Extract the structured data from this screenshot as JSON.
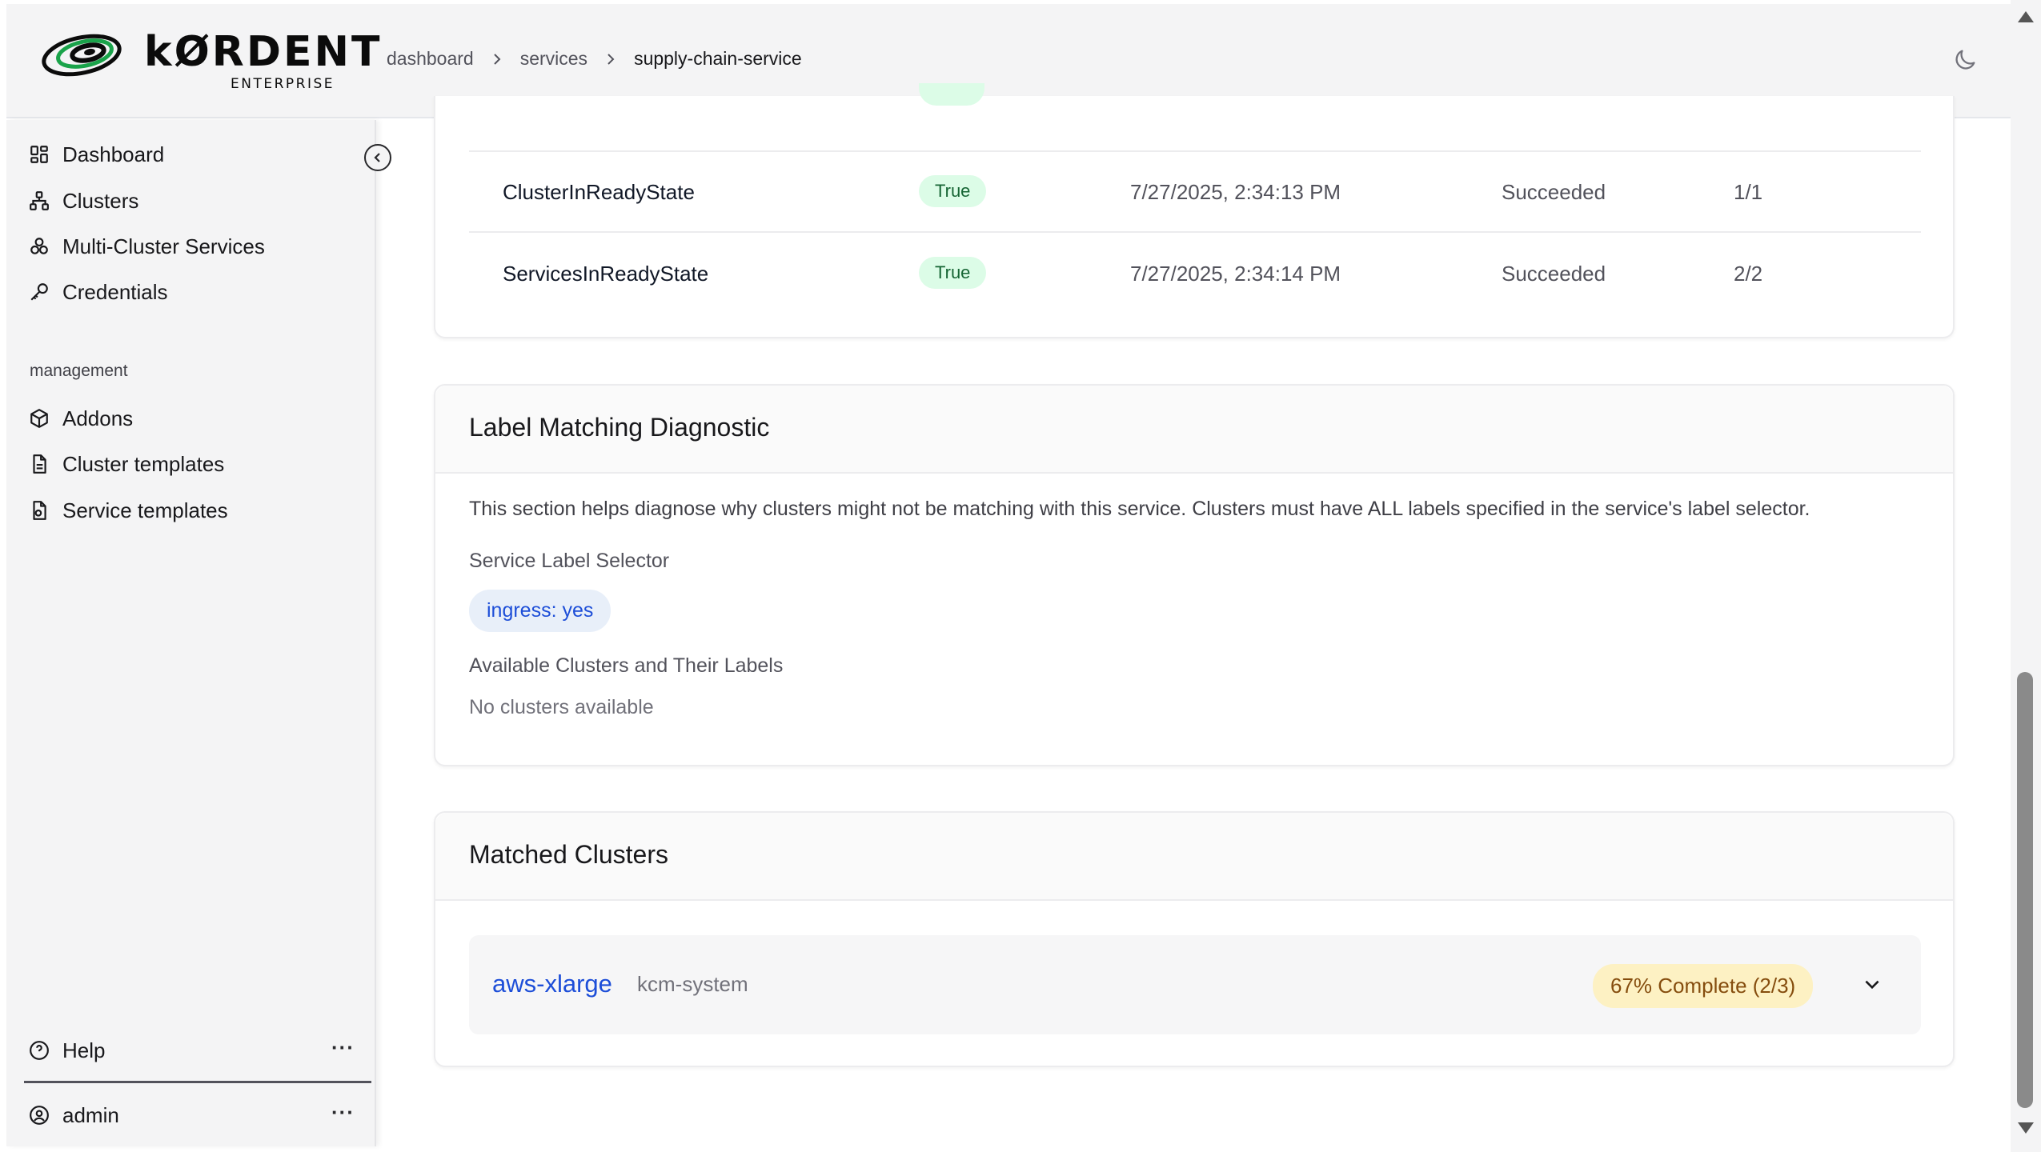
{
  "app": {
    "logo_text": "kØRDENT",
    "logo_sub": "ENTERPRISE"
  },
  "breadcrumb": {
    "items": [
      "dashboard",
      "services",
      "supply-chain-service"
    ]
  },
  "sidebar": {
    "items": [
      {
        "label": "Dashboard",
        "icon": "dashboard-icon"
      },
      {
        "label": "Clusters",
        "icon": "clusters-icon"
      },
      {
        "label": "Multi-Cluster Services",
        "icon": "multi-cluster-icon"
      },
      {
        "label": "Credentials",
        "icon": "key-icon"
      }
    ],
    "section_label": "management",
    "management_items": [
      {
        "label": "Addons",
        "icon": "box-icon"
      },
      {
        "label": "Cluster templates",
        "icon": "file-icon"
      },
      {
        "label": "Service templates",
        "icon": "file-settings-icon"
      }
    ],
    "help_label": "Help",
    "user_label": "admin",
    "more_glyph": "···"
  },
  "conditions": {
    "rows": [
      {
        "name": "ClusterInReadyState",
        "status": "True",
        "time": "7/27/2025, 2:34:13 PM",
        "result": "Succeeded",
        "count": "1/1"
      },
      {
        "name": "ServicesInReadyState",
        "status": "True",
        "time": "7/27/2025, 2:34:14 PM",
        "result": "Succeeded",
        "count": "2/2"
      }
    ]
  },
  "label_diag": {
    "title": "Label Matching Diagnostic",
    "description": "This section helps diagnose why clusters might not be matching with this service. Clusters must have ALL labels specified in the service's label selector.",
    "selector_label": "Service Label Selector",
    "selector_value": "ingress: yes",
    "available_label": "Available Clusters and Their Labels",
    "empty_text": "No clusters available"
  },
  "matched": {
    "title": "Matched Clusters",
    "cluster_name": "aws-xlarge",
    "namespace": "kcm-system",
    "progress_text": "67% Complete (2/3)",
    "progress_fraction": 0.67
  },
  "colors": {
    "accent": "#1d4ed8",
    "success_bg": "#dcfce7",
    "success_fg": "#166534",
    "warning_bg": "#fdf1c3",
    "warning_fg": "#854d0e"
  }
}
